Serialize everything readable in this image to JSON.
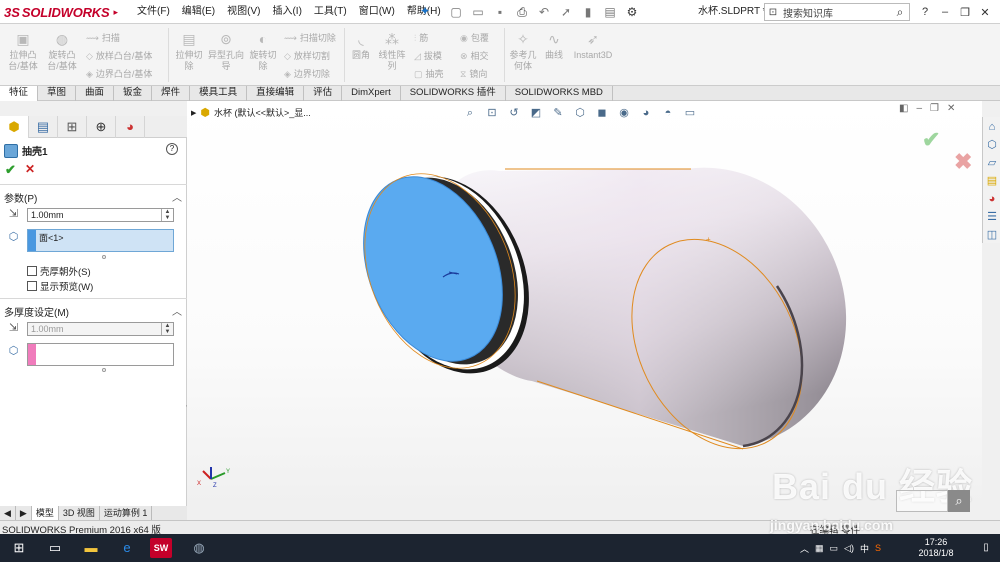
{
  "app": {
    "logo_ds": "3S",
    "logo_text": "SOLIDWORKS",
    "doc_name": "水杯.SLDPRT *"
  },
  "menu": [
    "文件(F)",
    "编辑(E)",
    "视图(V)",
    "插入(I)",
    "工具(T)",
    "窗口(W)",
    "帮助(H)"
  ],
  "search": {
    "placeholder": "搜索知识库"
  },
  "ribbon": {
    "extrude_boss": "拉伸凸台/基体",
    "revolve_boss": "旋转凸台/基体",
    "sweep": "扫描",
    "loft": "放样凸台/基体",
    "boundary": "边界凸台/基体",
    "extrude_cut": "拉伸切除",
    "hole_wizard": "异型孔向导",
    "revolve_cut": "旋转切除",
    "swept_cut": "扫描切除",
    "lofted_cut": "放样切割",
    "boundary_cut": "边界切除",
    "fillet": "圆角",
    "linear_pattern": "线性阵列",
    "rib": "筋",
    "draft": "拔模",
    "shell": "抽壳",
    "wrap": "包覆",
    "intersect": "相交",
    "mirror": "镜向",
    "ref_geometry": "参考几何体",
    "curves": "曲线",
    "instant3d": "Instant3D"
  },
  "tabs": [
    "特征",
    "草图",
    "曲面",
    "钣金",
    "焊件",
    "模具工具",
    "直接编辑",
    "评估",
    "DimXpert",
    "SOLIDWORKS 插件",
    "SOLIDWORKS MBD"
  ],
  "active_tab": "特征",
  "property_manager": {
    "feature_title": "抽壳1",
    "params_title": "参数(P)",
    "thickness": "1.00mm",
    "faces_item": "面<1>",
    "shell_outward": "壳厚朝外(S)",
    "show_preview": "显示预览(W)",
    "multi_title": "多厚度设定(M)",
    "multi_thickness": "1.00mm"
  },
  "viewport": {
    "tree_label": "水杯  (默认<<默认>_显..."
  },
  "bottom_tabs": [
    "模型",
    "3D 视图",
    "运动算例 1"
  ],
  "status": {
    "left": "SOLIDWORKS Premium 2016 x64 版",
    "right": "在编辑 零件"
  },
  "taskbar": {
    "time": "17:26",
    "date": "2018/1/8",
    "ime": "中"
  },
  "watermark": {
    "main": "Bai du 经验",
    "url": "jingyan.baidu.com"
  },
  "colors": {
    "brand_red": "#c4002a",
    "selected_face": "#5aaaf0",
    "highlight_edge": "#e08a1e",
    "confirm_green": "#2e9e2e",
    "cancel_red": "#cc2222"
  }
}
